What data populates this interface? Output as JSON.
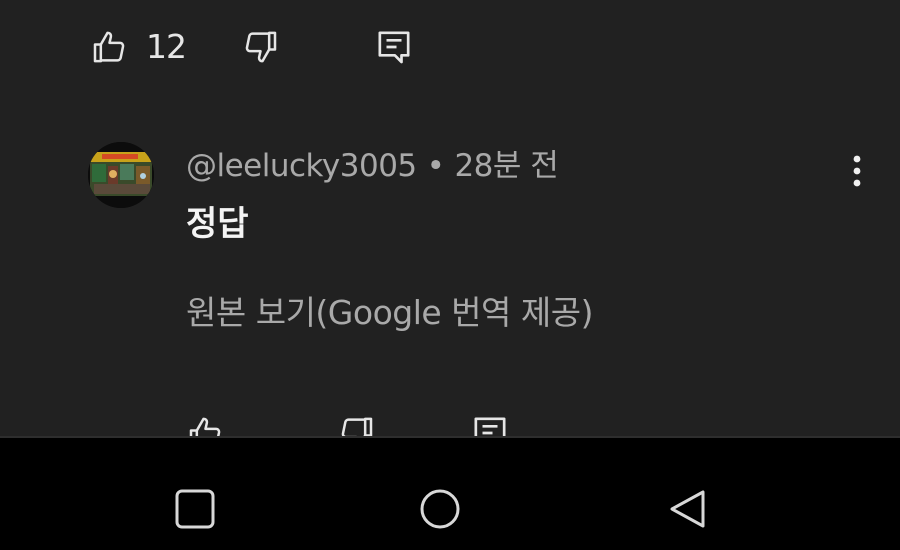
{
  "colors": {
    "background": "#212121",
    "primary_text": "#f4f4f4",
    "secondary_text": "#a9a9a9",
    "icon": "#e6e6e6",
    "navbar_background": "#000000"
  },
  "top_actions": {
    "like_icon": "thumbs-up-icon",
    "like_count": "12",
    "dislike_icon": "thumbs-down-icon",
    "reply_icon": "comment-icon"
  },
  "comment": {
    "avatar_icon": "user-avatar",
    "author": "@leelucky3005",
    "separator": "•",
    "time": "28분 전",
    "text": "정답",
    "translate_link": "원본 보기(Google 번역 제공)",
    "more_icon": "more-vertical-icon"
  },
  "bottom_actions": {
    "like_icon": "thumbs-up-icon",
    "dislike_icon": "thumbs-down-icon",
    "reply_icon": "comment-icon"
  },
  "navbar": {
    "recents_icon": "square-icon",
    "home_icon": "circle-icon",
    "back_icon": "triangle-back-icon"
  }
}
